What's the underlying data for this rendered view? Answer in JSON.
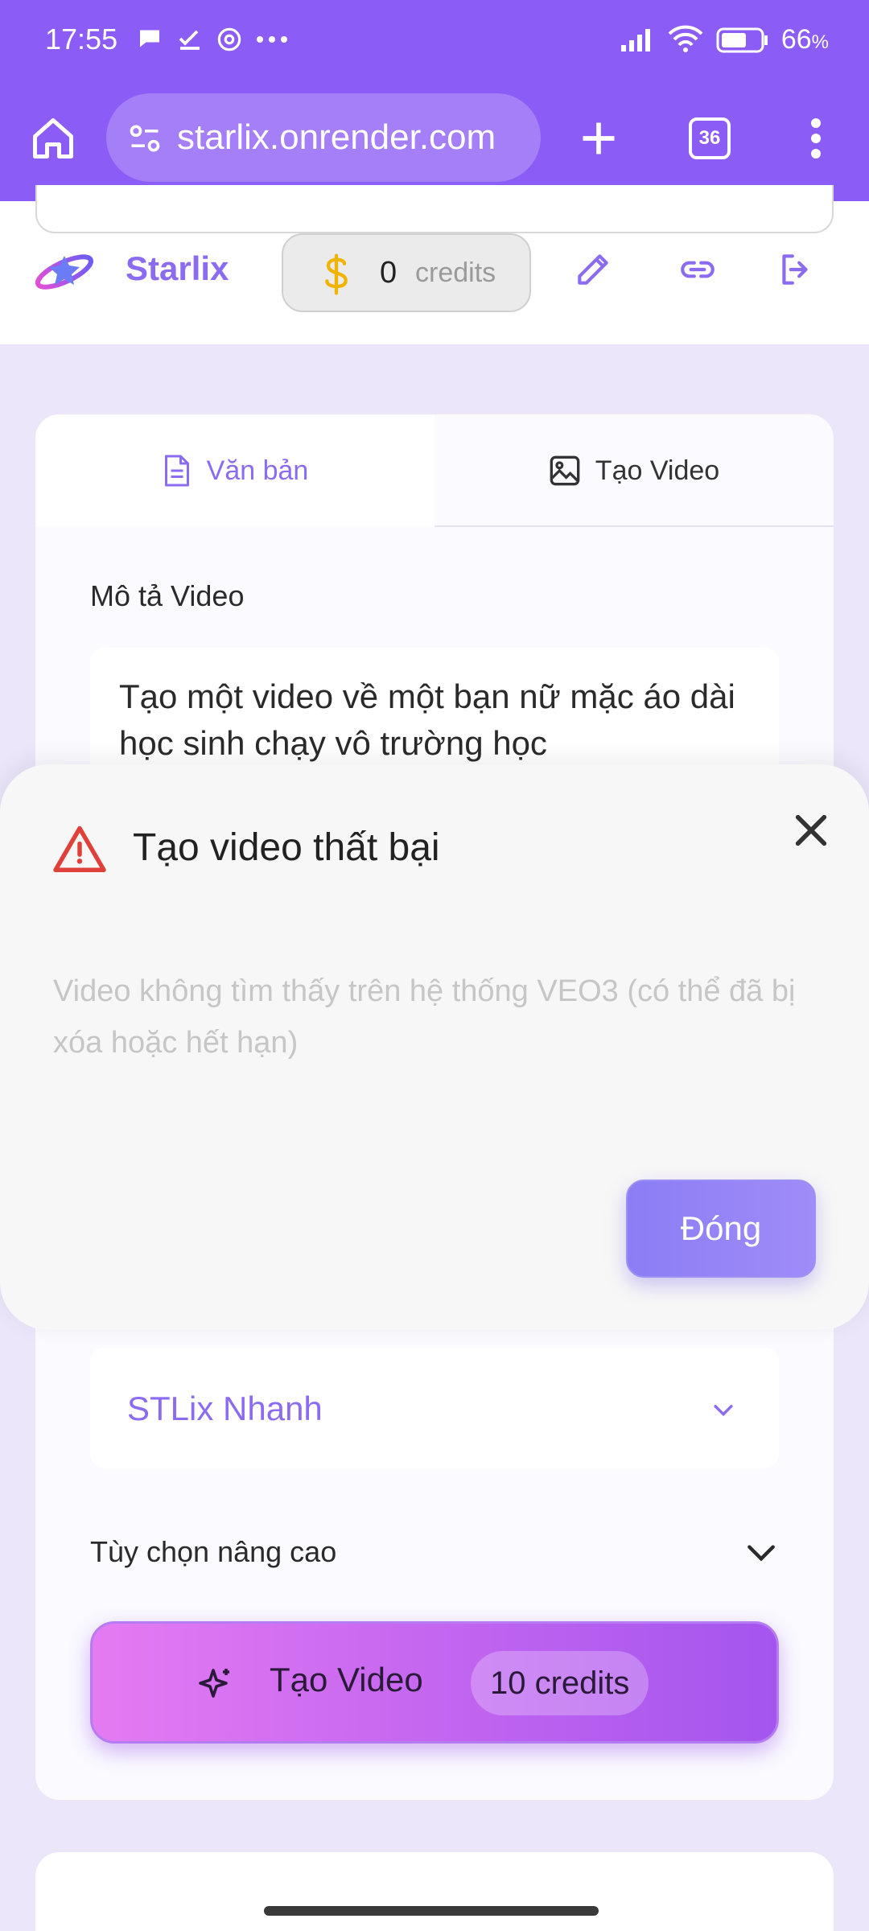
{
  "status_bar": {
    "time": "17:55",
    "battery": "66",
    "battery_unit": "%"
  },
  "browser": {
    "url": "starlix.onrender.com",
    "tab_count": "36"
  },
  "header": {
    "brand": "Starlix",
    "credits_value": "0",
    "credits_label": "credits"
  },
  "tabs": [
    {
      "label": "Văn bản",
      "icon": "document-icon",
      "active": true
    },
    {
      "label": "Tạo Video",
      "icon": "image-icon",
      "active": false
    }
  ],
  "form": {
    "description_label": "Mô tả Video",
    "description_value": "Tạo một video về một bạn nữ mặc áo dài học sinh chạy vô trường học",
    "model_select_value": "STLix Nhanh",
    "advanced_label": "Tùy chọn nâng cao",
    "generate_label": "Tạo Video",
    "generate_cost": "10 credits"
  },
  "dialog": {
    "title": "Tạo video thất bại",
    "message": "Video không tìm thấy trên hệ thống VEO3 (có thể đã bị xóa hoặc hết hạn)",
    "close_button": "Đóng"
  },
  "colors": {
    "accent": "#8b5cf6",
    "brand": "#8b6cf0",
    "warning": "#e0403a"
  }
}
